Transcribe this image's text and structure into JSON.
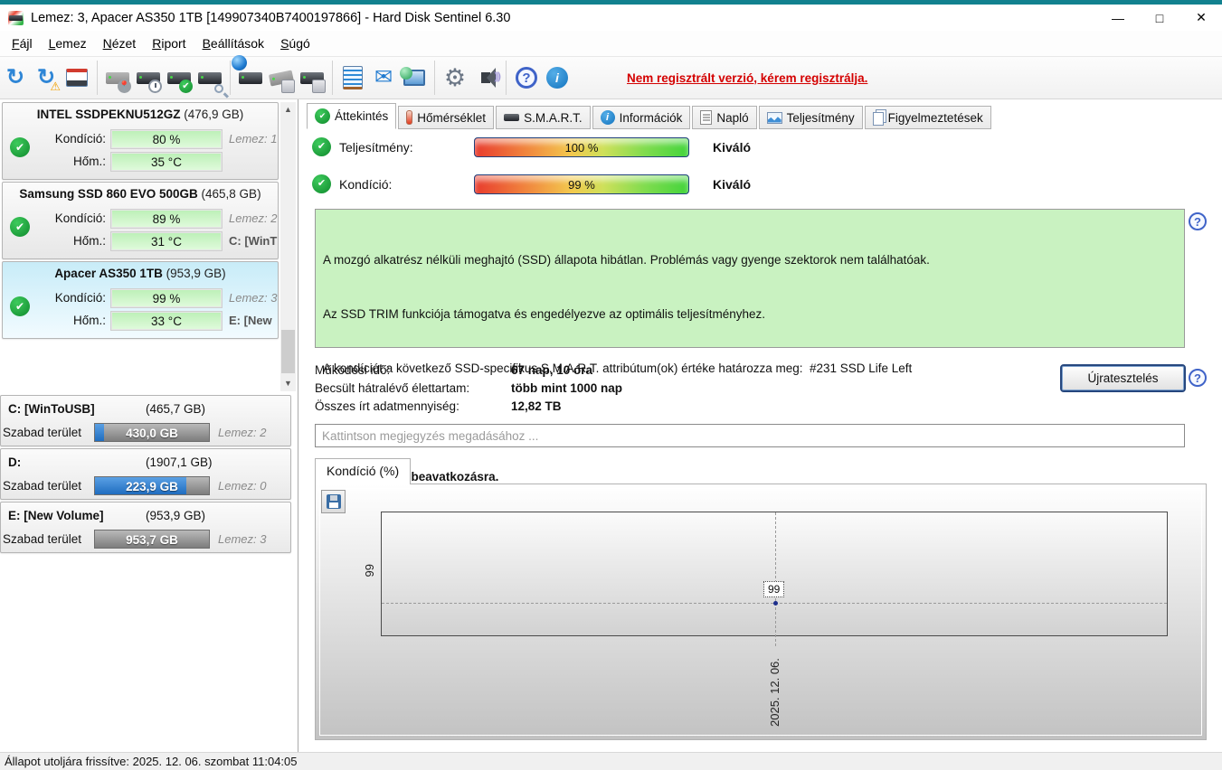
{
  "window": {
    "title": "Lemez: 3, Apacer AS350 1TB [149907340B7400197866]  -  Hard Disk Sentinel 6.30",
    "controls": {
      "minimize": "—",
      "maximize": "□",
      "close": "✕"
    }
  },
  "menu": {
    "items": [
      "Fájl",
      "Lemez",
      "Nézet",
      "Riport",
      "Beállítások",
      "Súgó"
    ]
  },
  "toolbar": {
    "icons": [
      "refresh-icon",
      "refresh-warning-icon",
      "disk-window-icon",
      "disk-location-icon",
      "disk-clock-icon",
      "disk-test-icon",
      "disk-search-icon",
      "disk-network-icon",
      "disk-remove-icon",
      "disk-insert-icon",
      "report-notepad-icon",
      "email-icon",
      "network-monitor-icon",
      "settings-gear-icon",
      "sound-icon",
      "help-icon",
      "info-icon"
    ],
    "registration_notice": "Nem regisztrált verzió, kérem regisztrálja."
  },
  "sidebar": {
    "labels": {
      "condition": "Kondíció:",
      "temperature": "Hőm.:",
      "free": "Szabad terület"
    },
    "disks": [
      {
        "name": "INTEL SSDPEKNU512GZ",
        "size": "(476,9 GB)",
        "condition": "80 %",
        "temp": "35 °C",
        "lemez": "Lemez: 1",
        "volume": ""
      },
      {
        "name": "Samsung SSD 860 EVO 500GB",
        "size": "(465,8 GB)",
        "condition": "89 %",
        "temp": "31 °C",
        "lemez": "Lemez: 2",
        "volume": "C: [WinT"
      },
      {
        "name": "Apacer AS350 1TB",
        "size": "(953,9 GB)",
        "condition": "99 %",
        "temp": "33 °C",
        "lemez": "Lemez: 3",
        "volume": "E: [New"
      }
    ],
    "partitions": [
      {
        "name": "C: [WinToUSB]",
        "size": "(465,7 GB)",
        "free": "430,0 GB",
        "lemez": "Lemez: 2",
        "used_pct": 8
      },
      {
        "name": "D:",
        "size": "(1907,1 GB)",
        "free": "223,9 GB",
        "lemez": "Lemez: 0",
        "used_pct": 80
      },
      {
        "name": "E: [New Volume]",
        "size": "(953,9 GB)",
        "free": "953,7 GB",
        "lemez": "Lemez: 3",
        "used_pct": 0
      }
    ]
  },
  "tabs": [
    {
      "label": "Áttekintés"
    },
    {
      "label": "Hőmérséklet"
    },
    {
      "label": "S.M.A.R.T."
    },
    {
      "label": "Információk"
    },
    {
      "label": "Napló"
    },
    {
      "label": "Teljesítmény"
    },
    {
      "label": "Figyelmeztetések"
    }
  ],
  "overview": {
    "performance": {
      "label": "Teljesítmény:",
      "value": "100 %",
      "rating": "Kiváló"
    },
    "condition": {
      "label": "Kondíció:",
      "value": "99 %",
      "rating": "Kiváló"
    },
    "status_lines": [
      "A mozgó alkatrész nélküli meghajtó (SSD) állapota hibátlan. Problémás vagy gyenge szektorok nem találhatóak.",
      "Az SSD TRIM funkciója támogatva és engedélyezve az optimális teljesítményhez.",
      "A kondíciót a következő SSD-specifikus S.M.A.R.T. attribútum(ok) értéke határozza meg:  #231 SSD Life Left"
    ],
    "advice": "Nincs szükség beavatkozásra.",
    "stats": [
      {
        "label": "Működési idő:",
        "value": "67 nap, 10 óra"
      },
      {
        "label": "Becsült hátralévő élettartam:",
        "value": "több mint 1000 nap"
      },
      {
        "label": "Összes írt adatmennyiség:",
        "value": "12,82 TB"
      }
    ],
    "retest_button": "Újratesztelés",
    "comment_placeholder": "Kattintson megjegyzés megadásához ..."
  },
  "chart": {
    "tab_label": "Kondíció  (%)",
    "y_tick": "99",
    "point_label": "99",
    "x_tick": "2025. 12. 06.",
    "chart_data": {
      "type": "line",
      "title": "Kondíció (%)",
      "x": [
        "2025. 12. 06."
      ],
      "values": [
        99
      ],
      "ylabel": "Kondíció (%)",
      "grid": "dashed-crosshair",
      "legend_position": "none"
    }
  },
  "statusbar": {
    "text": "Állapot utoljára frissítve: 2025. 12. 06. szombat 11:04:05"
  }
}
